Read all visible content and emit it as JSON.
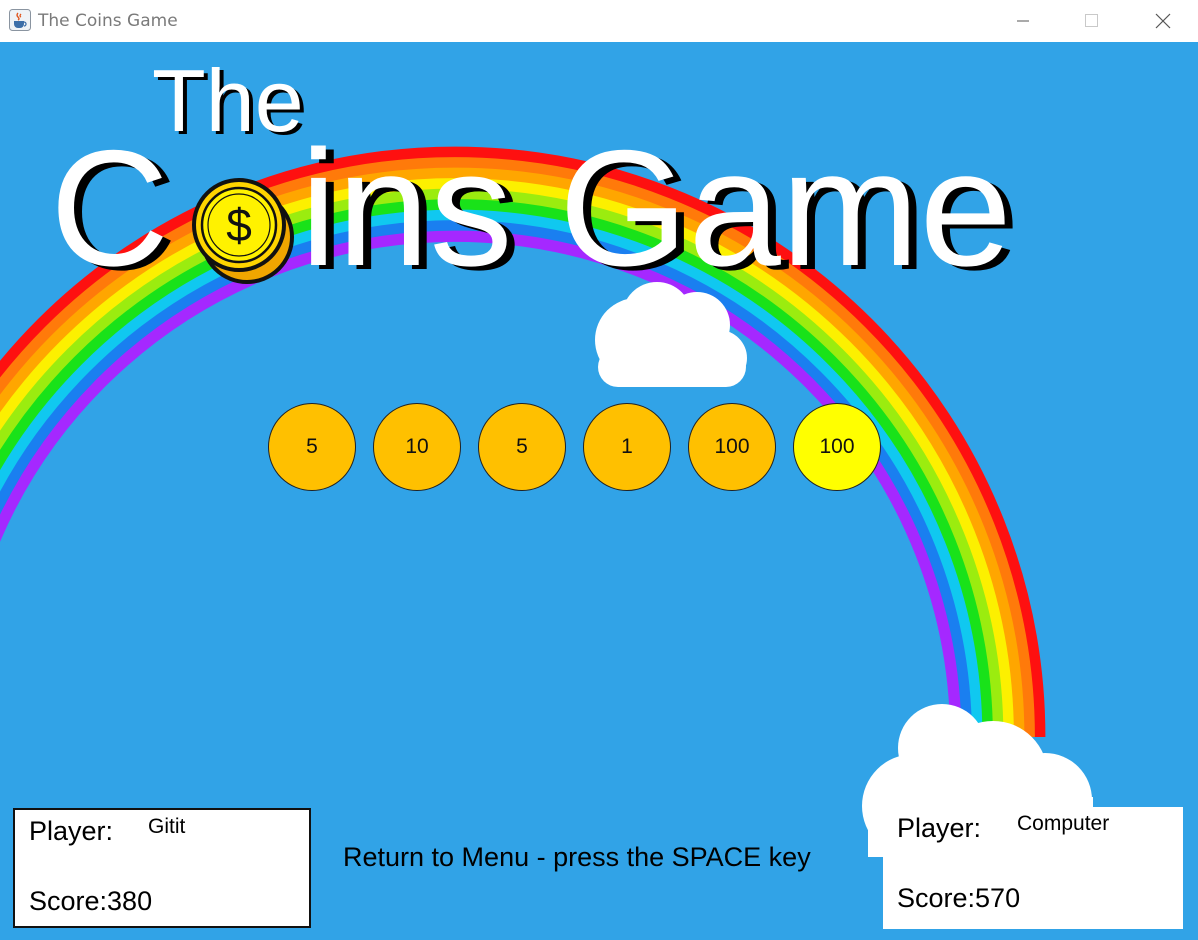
{
  "window": {
    "title": "The Coins Game",
    "icon": "java-cup-icon",
    "controls": [
      "minimize-icon",
      "maximize-icon",
      "close-icon"
    ]
  },
  "logo": {
    "line1": "The",
    "line2_start": "C",
    "line2_coin_symbol": "$",
    "line2_end": "ins Game"
  },
  "coins": [
    {
      "value": "5",
      "color": "#ffc000"
    },
    {
      "value": "10",
      "color": "#ffc000"
    },
    {
      "value": "5",
      "color": "#ffc000"
    },
    {
      "value": "1",
      "color": "#ffc000"
    },
    {
      "value": "100",
      "color": "#ffc000"
    },
    {
      "value": "100",
      "color": "#ffff00"
    }
  ],
  "player": {
    "label": "Player:",
    "name": "Gitit",
    "score_text": "Score:380"
  },
  "computer": {
    "label": "Player:",
    "name": "Computer",
    "score_text": "Score:570"
  },
  "hint": "Return to Menu - press the SPACE key",
  "colors": {
    "sky": "#31a3e7",
    "rainbow": [
      "#fe1010",
      "#ff7a0a",
      "#ffa600",
      "#fcf000",
      "#9bec0f",
      "#19e219",
      "#10c8f0",
      "#1a7ff0",
      "#a528ff"
    ]
  }
}
